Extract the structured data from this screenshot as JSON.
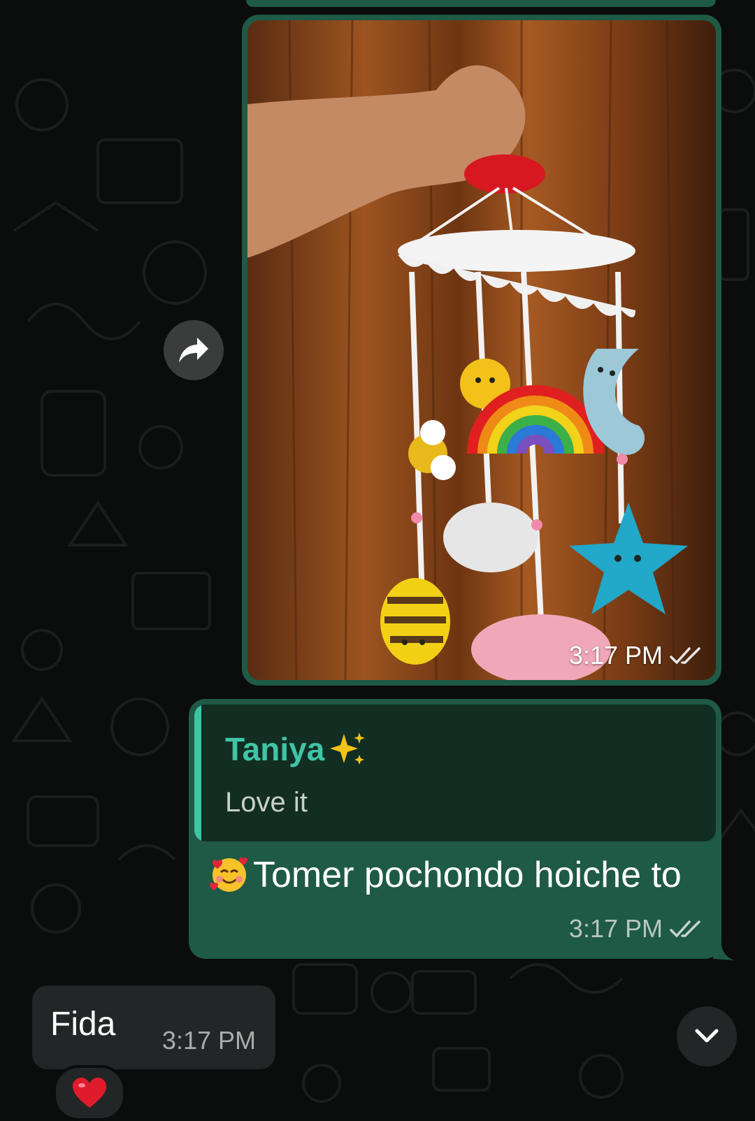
{
  "image_message": {
    "time": "3:17 PM",
    "status_icon": "double-check-icon",
    "photo_subject": "crochet-baby-mobile-photo"
  },
  "forward_button": {
    "icon": "forward-arrow-icon"
  },
  "reply_message": {
    "quoted_sender": "Taniya",
    "quoted_sender_emoji": "sparkles-icon",
    "quoted_text": "Love it",
    "emoji": "smiling-face-with-hearts-icon",
    "text": "Tomer pochondo hoiche to",
    "time": "3:17 PM",
    "status_icon": "double-check-icon"
  },
  "incoming_message": {
    "text": "Fida",
    "time": "3:17 PM",
    "reaction_icon": "red-heart-icon"
  },
  "scroll_down_button": {
    "icon": "chevron-down-icon"
  },
  "colors": {
    "background": "#0b0c0c",
    "outgoing_bubble": "#1e5a45",
    "quote_background": "#122d22",
    "quote_accent": "#3fc5a6",
    "incoming_bubble": "#232626"
  }
}
